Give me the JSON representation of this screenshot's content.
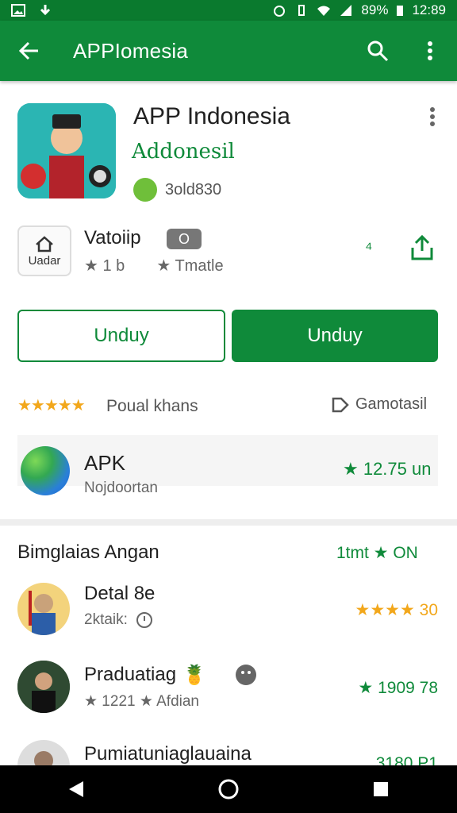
{
  "status_bar": {
    "battery": "89%",
    "time": "12:89"
  },
  "app_bar": {
    "title": "APPIomesia"
  },
  "app": {
    "title": "APP Indonesia",
    "developer": "Addonesil",
    "meta": "3old830"
  },
  "info": {
    "tile_label": "Uadar",
    "title": "Vatoiip",
    "chip": "O",
    "left_stat": "1 b",
    "right_stat": "Tmatle"
  },
  "buttons": {
    "outline": "Unduy",
    "filled": "Unduy"
  },
  "rating": {
    "stars": "★★★★★",
    "text": "Poual khans",
    "right": "Gamotasil"
  },
  "apk": {
    "title": "APK",
    "subtitle": "Nojdoortan",
    "right": "★ 12.75 un"
  },
  "section": {
    "title": "Bimglaias Angan",
    "right": "1tmt ★ ON"
  },
  "list": [
    {
      "title": "Detal 8e",
      "sub": "2ktaik:",
      "right": "★★★★ 30"
    },
    {
      "title": "Praduatiag",
      "sub": "★ 1221 ★ Afdian",
      "right": "★ 1909 78"
    },
    {
      "title": "Pumiatuniaglauaina",
      "sub": "",
      "right": "3180 P1"
    }
  ],
  "colors": {
    "primary": "#0f8a3a",
    "status_bar": "#0a7a2e",
    "star": "#f2a71b"
  }
}
